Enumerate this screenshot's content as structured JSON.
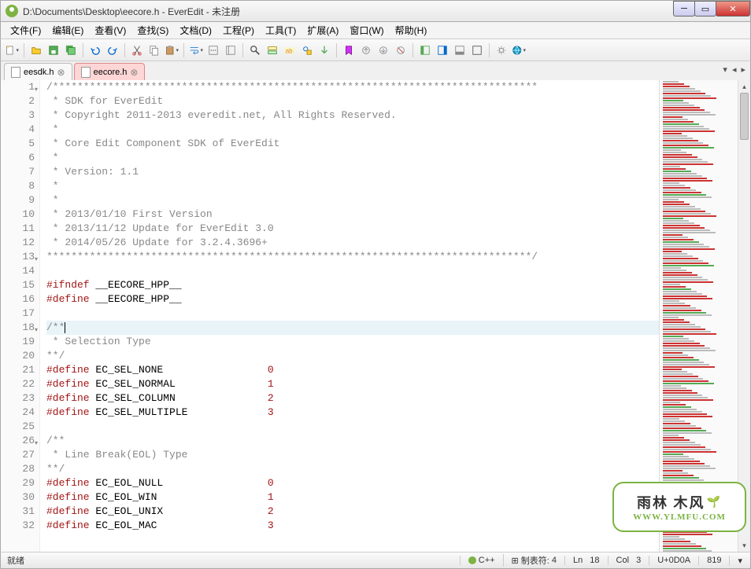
{
  "window": {
    "title": "D:\\Documents\\Desktop\\eecore.h - EverEdit - 未注册"
  },
  "menu": {
    "file": "文件(F)",
    "edit": "编辑(E)",
    "view": "查看(V)",
    "search": "查找(S)",
    "doc": "文档(D)",
    "project": "工程(P)",
    "tool": "工具(T)",
    "ext": "扩展(A)",
    "window": "窗口(W)",
    "help": "帮助(H)"
  },
  "tabs": [
    {
      "label": "eesdk.h",
      "active": false
    },
    {
      "label": "eecore.h",
      "active": true
    }
  ],
  "code": {
    "lines": [
      {
        "n": 1,
        "fold": true,
        "cls": "c-comment",
        "t": "/*******************************************************************************"
      },
      {
        "n": 2,
        "cls": "c-comment",
        "t": " * SDK for EverEdit"
      },
      {
        "n": 3,
        "cls": "c-comment",
        "t": " * Copyright 2011-2013 everedit.net, All Rights Reserved."
      },
      {
        "n": 4,
        "cls": "c-comment",
        "t": " *"
      },
      {
        "n": 5,
        "cls": "c-comment",
        "t": " * Core Edit Component SDK of EverEdit"
      },
      {
        "n": 6,
        "cls": "c-comment",
        "t": " *"
      },
      {
        "n": 7,
        "cls": "c-comment",
        "t": " * Version: 1.1"
      },
      {
        "n": 8,
        "cls": "c-comment",
        "t": " *"
      },
      {
        "n": 9,
        "cls": "c-comment",
        "t": " *"
      },
      {
        "n": 10,
        "cls": "c-comment",
        "t": " * 2013/01/10 First Version"
      },
      {
        "n": 11,
        "cls": "c-comment",
        "t": " * 2013/11/12 Update for EverEdit 3.0"
      },
      {
        "n": 12,
        "cls": "c-comment",
        "t": " * 2014/05/26 Update for 3.2.4.3696+"
      },
      {
        "n": 13,
        "fold": true,
        "cls": "c-comment",
        "t": "*******************************************************************************/"
      },
      {
        "n": 14,
        "cls": "",
        "t": ""
      },
      {
        "n": 15,
        "kw": "#ifndef",
        "rest": " __EECORE_HPP__"
      },
      {
        "n": 16,
        "kw": "#define",
        "rest": " __EECORE_HPP__"
      },
      {
        "n": 17,
        "cls": "",
        "t": ""
      },
      {
        "n": 18,
        "fold": true,
        "current": true,
        "cls": "c-comment",
        "t": "/**"
      },
      {
        "n": 19,
        "cls": "c-comment",
        "t": " * Selection Type"
      },
      {
        "n": 20,
        "cls": "c-comment",
        "t": "**/"
      },
      {
        "n": 21,
        "kw": "#define",
        "rest": " EC_SEL_NONE                 ",
        "num": "0"
      },
      {
        "n": 22,
        "kw": "#define",
        "rest": " EC_SEL_NORMAL               ",
        "num": "1"
      },
      {
        "n": 23,
        "kw": "#define",
        "rest": " EC_SEL_COLUMN               ",
        "num": "2"
      },
      {
        "n": 24,
        "kw": "#define",
        "rest": " EC_SEL_MULTIPLE             ",
        "num": "3"
      },
      {
        "n": 25,
        "cls": "",
        "t": ""
      },
      {
        "n": 26,
        "fold": true,
        "cls": "c-comment",
        "t": "/**"
      },
      {
        "n": 27,
        "cls": "c-comment",
        "t": " * Line Break(EOL) Type"
      },
      {
        "n": 28,
        "cls": "c-comment",
        "t": "**/"
      },
      {
        "n": 29,
        "kw": "#define",
        "rest": " EC_EOL_NULL                 ",
        "num": "0"
      },
      {
        "n": 30,
        "kw": "#define",
        "rest": " EC_EOL_WIN                  ",
        "num": "1"
      },
      {
        "n": 31,
        "kw": "#define",
        "rest": " EC_EOL_UNIX                 ",
        "num": "2"
      },
      {
        "n": 32,
        "kw": "#define",
        "rest": " EC_EOL_MAC                  ",
        "num": "3"
      }
    ]
  },
  "status": {
    "ready": "就绪",
    "lang": "C++",
    "tabstop_label": "制表符:",
    "tabstop_val": "4",
    "ln_label": "Ln",
    "ln_val": "18",
    "col_label": "Col",
    "col_val": "3",
    "unicode": "U+0D0A",
    "bytes": "819"
  },
  "watermark": {
    "cn": "雨林 木风",
    "url": "WWW.YLMFU.COM"
  }
}
